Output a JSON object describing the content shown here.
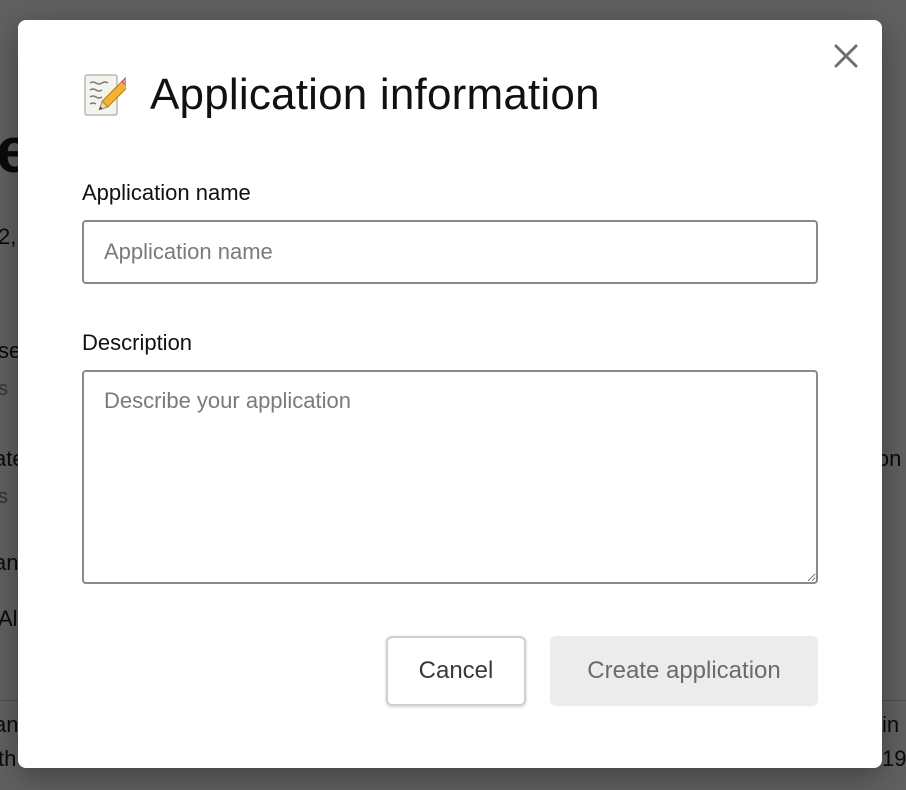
{
  "background": {
    "fragments": [
      "e",
      "2,",
      "se",
      "s",
      "ate",
      "ion",
      "s",
      "an",
      "Al",
      "an",
      "in",
      "th",
      "19"
    ]
  },
  "modal": {
    "title": "Application information",
    "title_icon": "memo-icon",
    "close_icon": "close-icon",
    "fields": {
      "name": {
        "label": "Application name",
        "value": "",
        "placeholder": "Application name"
      },
      "description": {
        "label": "Description",
        "value": "",
        "placeholder": "Describe your application"
      }
    },
    "buttons": {
      "cancel_label": "Cancel",
      "create_label": "Create application",
      "create_disabled": true
    }
  },
  "colors": {
    "overlay": "#000000",
    "input_border": "#8a8a8a",
    "create_button_bg": "#ececec",
    "create_button_text": "#6b6b6b"
  }
}
